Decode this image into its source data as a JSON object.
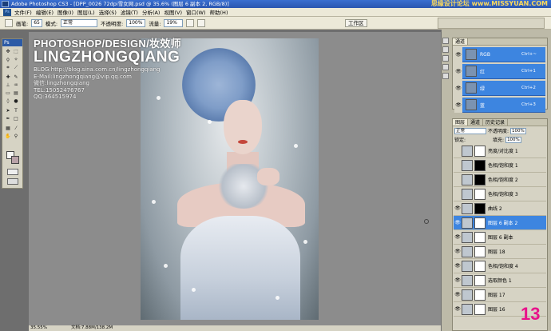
{
  "window": {
    "title": "Adobe Photoshop CS3 - [DPP_0026 72dpi雪女网.psd @ 35.6% (图层 6 副本 2, RGB/8)]",
    "watermark": "思缘设计论坛 www.MISSYUAN.COM"
  },
  "menu": {
    "logo": "Ps",
    "items": [
      "文件(F)",
      "编辑(E)",
      "图像(I)",
      "图层(L)",
      "选择(S)",
      "滤镜(T)",
      "分析(A)",
      "视图(V)",
      "窗口(W)",
      "帮助(H)"
    ]
  },
  "options": {
    "brush_label": "画笔:",
    "brush_size": "65",
    "mode_label": "模式:",
    "mode_value": "正常",
    "opacity_label": "不透明度:",
    "opacity_value": "100%",
    "flow_label": "流量:",
    "flow_value": "19%",
    "workspace": "工作区"
  },
  "tools": {
    "header": "Ps",
    "colors": {
      "foreground": "#f8f8f6",
      "background": "#b9a2a8"
    }
  },
  "document": {
    "overlay_title": "PHOTOSHOP/DESIGN/妆效师",
    "overlay_name": "LINGZHONGQIANG",
    "info_lines": [
      "BLOG:http://blog.sina.com.cn/lingzhongqiang",
      "E-Mail:lingzhongqiang@vip.qq.com",
      "微信:lingzhongqiang",
      "TEL:15052476767",
      "QQ:364515974"
    ],
    "status_zoom": "35.55%",
    "status_doc": "文档:7.88M/138.2M"
  },
  "channels": {
    "tabs": [
      "通道"
    ],
    "rows": [
      {
        "name": "RGB",
        "key": "Ctrl+~"
      },
      {
        "name": "红",
        "key": "Ctrl+1"
      },
      {
        "name": "绿",
        "key": "Ctrl+2"
      },
      {
        "name": "蓝",
        "key": "Ctrl+3"
      }
    ]
  },
  "layers": {
    "tabs": [
      "图层",
      "通道",
      "历史记录"
    ],
    "blend_mode": "正常",
    "opacity_label": "不透明度:",
    "opacity_value": "100%",
    "lock_label": "锁定:",
    "fill_label": "填充:",
    "fill_value": "100%",
    "rows": [
      {
        "name": "亮度/对比度 1",
        "visible": false,
        "mask": "white",
        "selected": false
      },
      {
        "name": "色相/饱和度 1",
        "visible": false,
        "mask": "black",
        "selected": false
      },
      {
        "name": "色相/饱和度 2",
        "visible": false,
        "mask": "black",
        "selected": false
      },
      {
        "name": "色相/饱和度 3",
        "visible": false,
        "mask": "white",
        "selected": false
      },
      {
        "name": "曲线 2",
        "visible": true,
        "mask": "black",
        "selected": false
      },
      {
        "name": "图层 6 副本 2",
        "visible": true,
        "mask": "white",
        "selected": true
      },
      {
        "name": "图层 6 副本",
        "visible": true,
        "mask": "white",
        "selected": false
      },
      {
        "name": "图层 18",
        "visible": true,
        "mask": "white",
        "selected": false
      },
      {
        "name": "色相/饱和度 4",
        "visible": true,
        "mask": "white",
        "selected": false
      },
      {
        "name": "选取颜色 1",
        "visible": true,
        "mask": "white",
        "selected": false
      },
      {
        "name": "图层 17",
        "visible": true,
        "mask": "white",
        "selected": false
      },
      {
        "name": "图层 16",
        "visible": true,
        "mask": "white",
        "selected": false
      }
    ]
  },
  "step_number": "13"
}
